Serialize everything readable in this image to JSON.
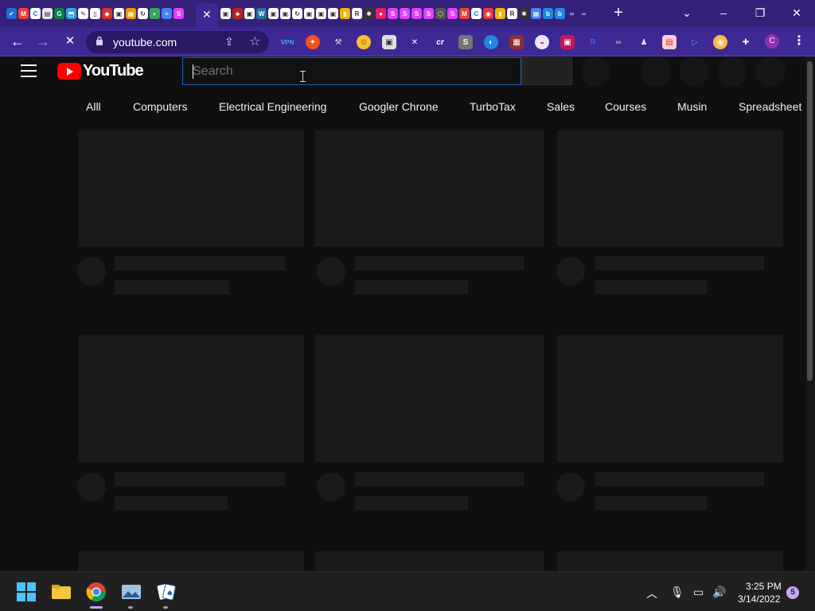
{
  "browser": {
    "active_tab_close": "✕",
    "new_tab": "+",
    "window_controls": {
      "minimize": "–",
      "restore": "❐",
      "close": "✕",
      "tab_search": "⌄"
    },
    "nav": {
      "back": "←",
      "forward": "→",
      "stop": "✕"
    },
    "address": {
      "url": "youtube.com"
    },
    "profile_initial": "C",
    "menu": "⋮"
  },
  "youtube": {
    "search": {
      "placeholder": "Search",
      "value": ""
    },
    "logo_text": "YouTube",
    "chips": [
      "Alll",
      "Computers",
      "Electrical Engineering",
      "Googler Chrone",
      "TurboTax",
      "Sales",
      "Courses",
      "Musin",
      "Spreadsheet"
    ]
  },
  "taskbar": {
    "time": "3:25 PM",
    "date": "3/14/2022",
    "notification_count": "5"
  },
  "colors": {
    "chrome_tabstrip": "#35207a",
    "chrome_toolbar": "#3e2893",
    "youtube_bg": "#0f0f0f",
    "youtube_red": "#ff0000",
    "search_focus": "#1c62b9"
  }
}
